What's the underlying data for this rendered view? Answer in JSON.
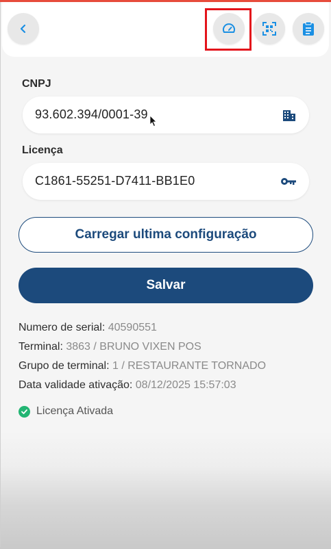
{
  "form": {
    "cnpj_label": "CNPJ",
    "cnpj_value": "93.602.394/0001-39",
    "license_label": "Licença",
    "license_value": "C1861-55251-D7411-BB1E0"
  },
  "buttons": {
    "load_last_config": "Carregar ultima configuração",
    "save": "Salvar"
  },
  "info": {
    "serial_label": "Numero de serial:",
    "serial_value": "40590551",
    "terminal_label": "Terminal:",
    "terminal_value": "3863 / BRUNO VIXEN POS",
    "group_label": "Grupo de terminal:",
    "group_value": "1 / RESTAURANTE TORNADO",
    "validity_label": "Data validade ativação:",
    "validity_value": "08/12/2025 15:57:03"
  },
  "status": {
    "license_active": "Licença Ativada"
  },
  "colors": {
    "primary": "#1c4a7c",
    "icon_blue": "#1a8fe3",
    "success": "#22b573",
    "highlight": "#e3131b"
  },
  "icons": [
    "chevron-left-icon",
    "speedometer-icon",
    "qr-scan-icon",
    "clipboard-icon",
    "building-icon",
    "key-icon",
    "check-circle-icon",
    "mouse-cursor-icon"
  ]
}
